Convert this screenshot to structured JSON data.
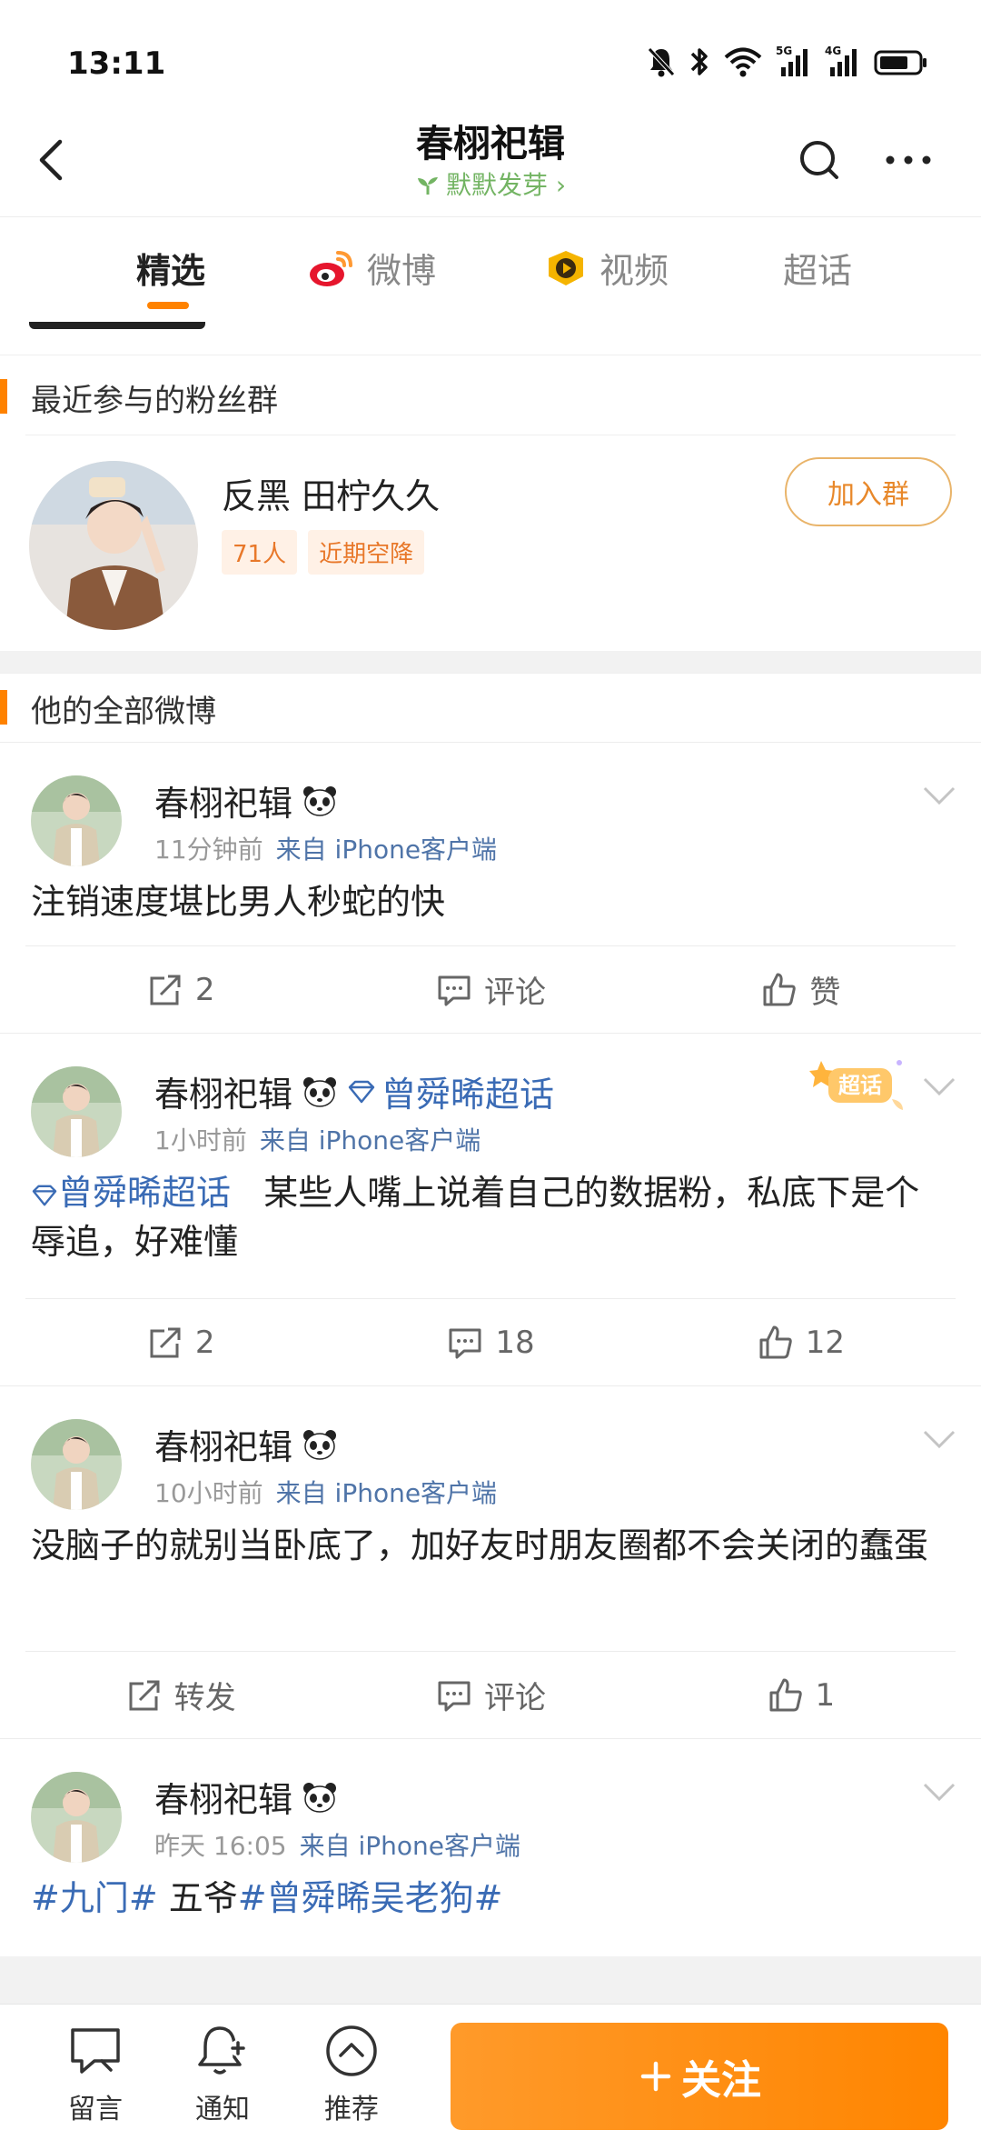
{
  "status_bar": {
    "time": "13:11"
  },
  "header": {
    "title": "春栩祀辑",
    "subtitle": "默默发芽 ›"
  },
  "tabs": [
    {
      "label": "精选"
    },
    {
      "label": "微博"
    },
    {
      "label": "视频"
    },
    {
      "label": "超话"
    }
  ],
  "fan_groups": {
    "section_title": "最近参与的粉丝群",
    "group": {
      "name": "反黑 田柠久久",
      "members": "71人",
      "tag": "近期空降",
      "join_label": "加入群"
    }
  },
  "all_posts": {
    "section_title": "他的全部微博",
    "posts": [
      {
        "author": "春栩祀辑",
        "time": "11分钟前",
        "source": "来自 iPhone客户端",
        "text": "注销速度堪比男人秒蛇的快",
        "repost": "2",
        "comment": "评论",
        "like": "赞"
      },
      {
        "author": "春栩祀辑",
        "topic": "曾舜晞超话",
        "sticker": "超话",
        "time": "1小时前",
        "source": "来自 iPhone客户端",
        "text_link": "曾舜晞超话",
        "text": "某些人嘴上说着自己的数据粉，私底下是个辱追，好难懂",
        "repost": "2",
        "comment": "18",
        "like": "12"
      },
      {
        "author": "春栩祀辑",
        "time": "10小时前",
        "source": "来自 iPhone客户端",
        "text": "没脑子的就别当卧底了，加好友时朋友圈都不会关闭的蠢蛋",
        "repost": "转发",
        "comment": "评论",
        "like": "1"
      },
      {
        "author": "春栩祀辑",
        "time": "昨天 16:05",
        "source": "来自 iPhone客户端",
        "hashtag1": "#九门#",
        "text_mid": " 五爷",
        "hashtag2": "#曾舜晞吴老狗#"
      }
    ]
  },
  "bottom_bar": {
    "message": "留言",
    "notify": "通知",
    "recommend": "推荐",
    "follow": "关注"
  },
  "colors": {
    "accent": "#ff8200",
    "link": "#3a6bb5",
    "green": "#73b463"
  }
}
